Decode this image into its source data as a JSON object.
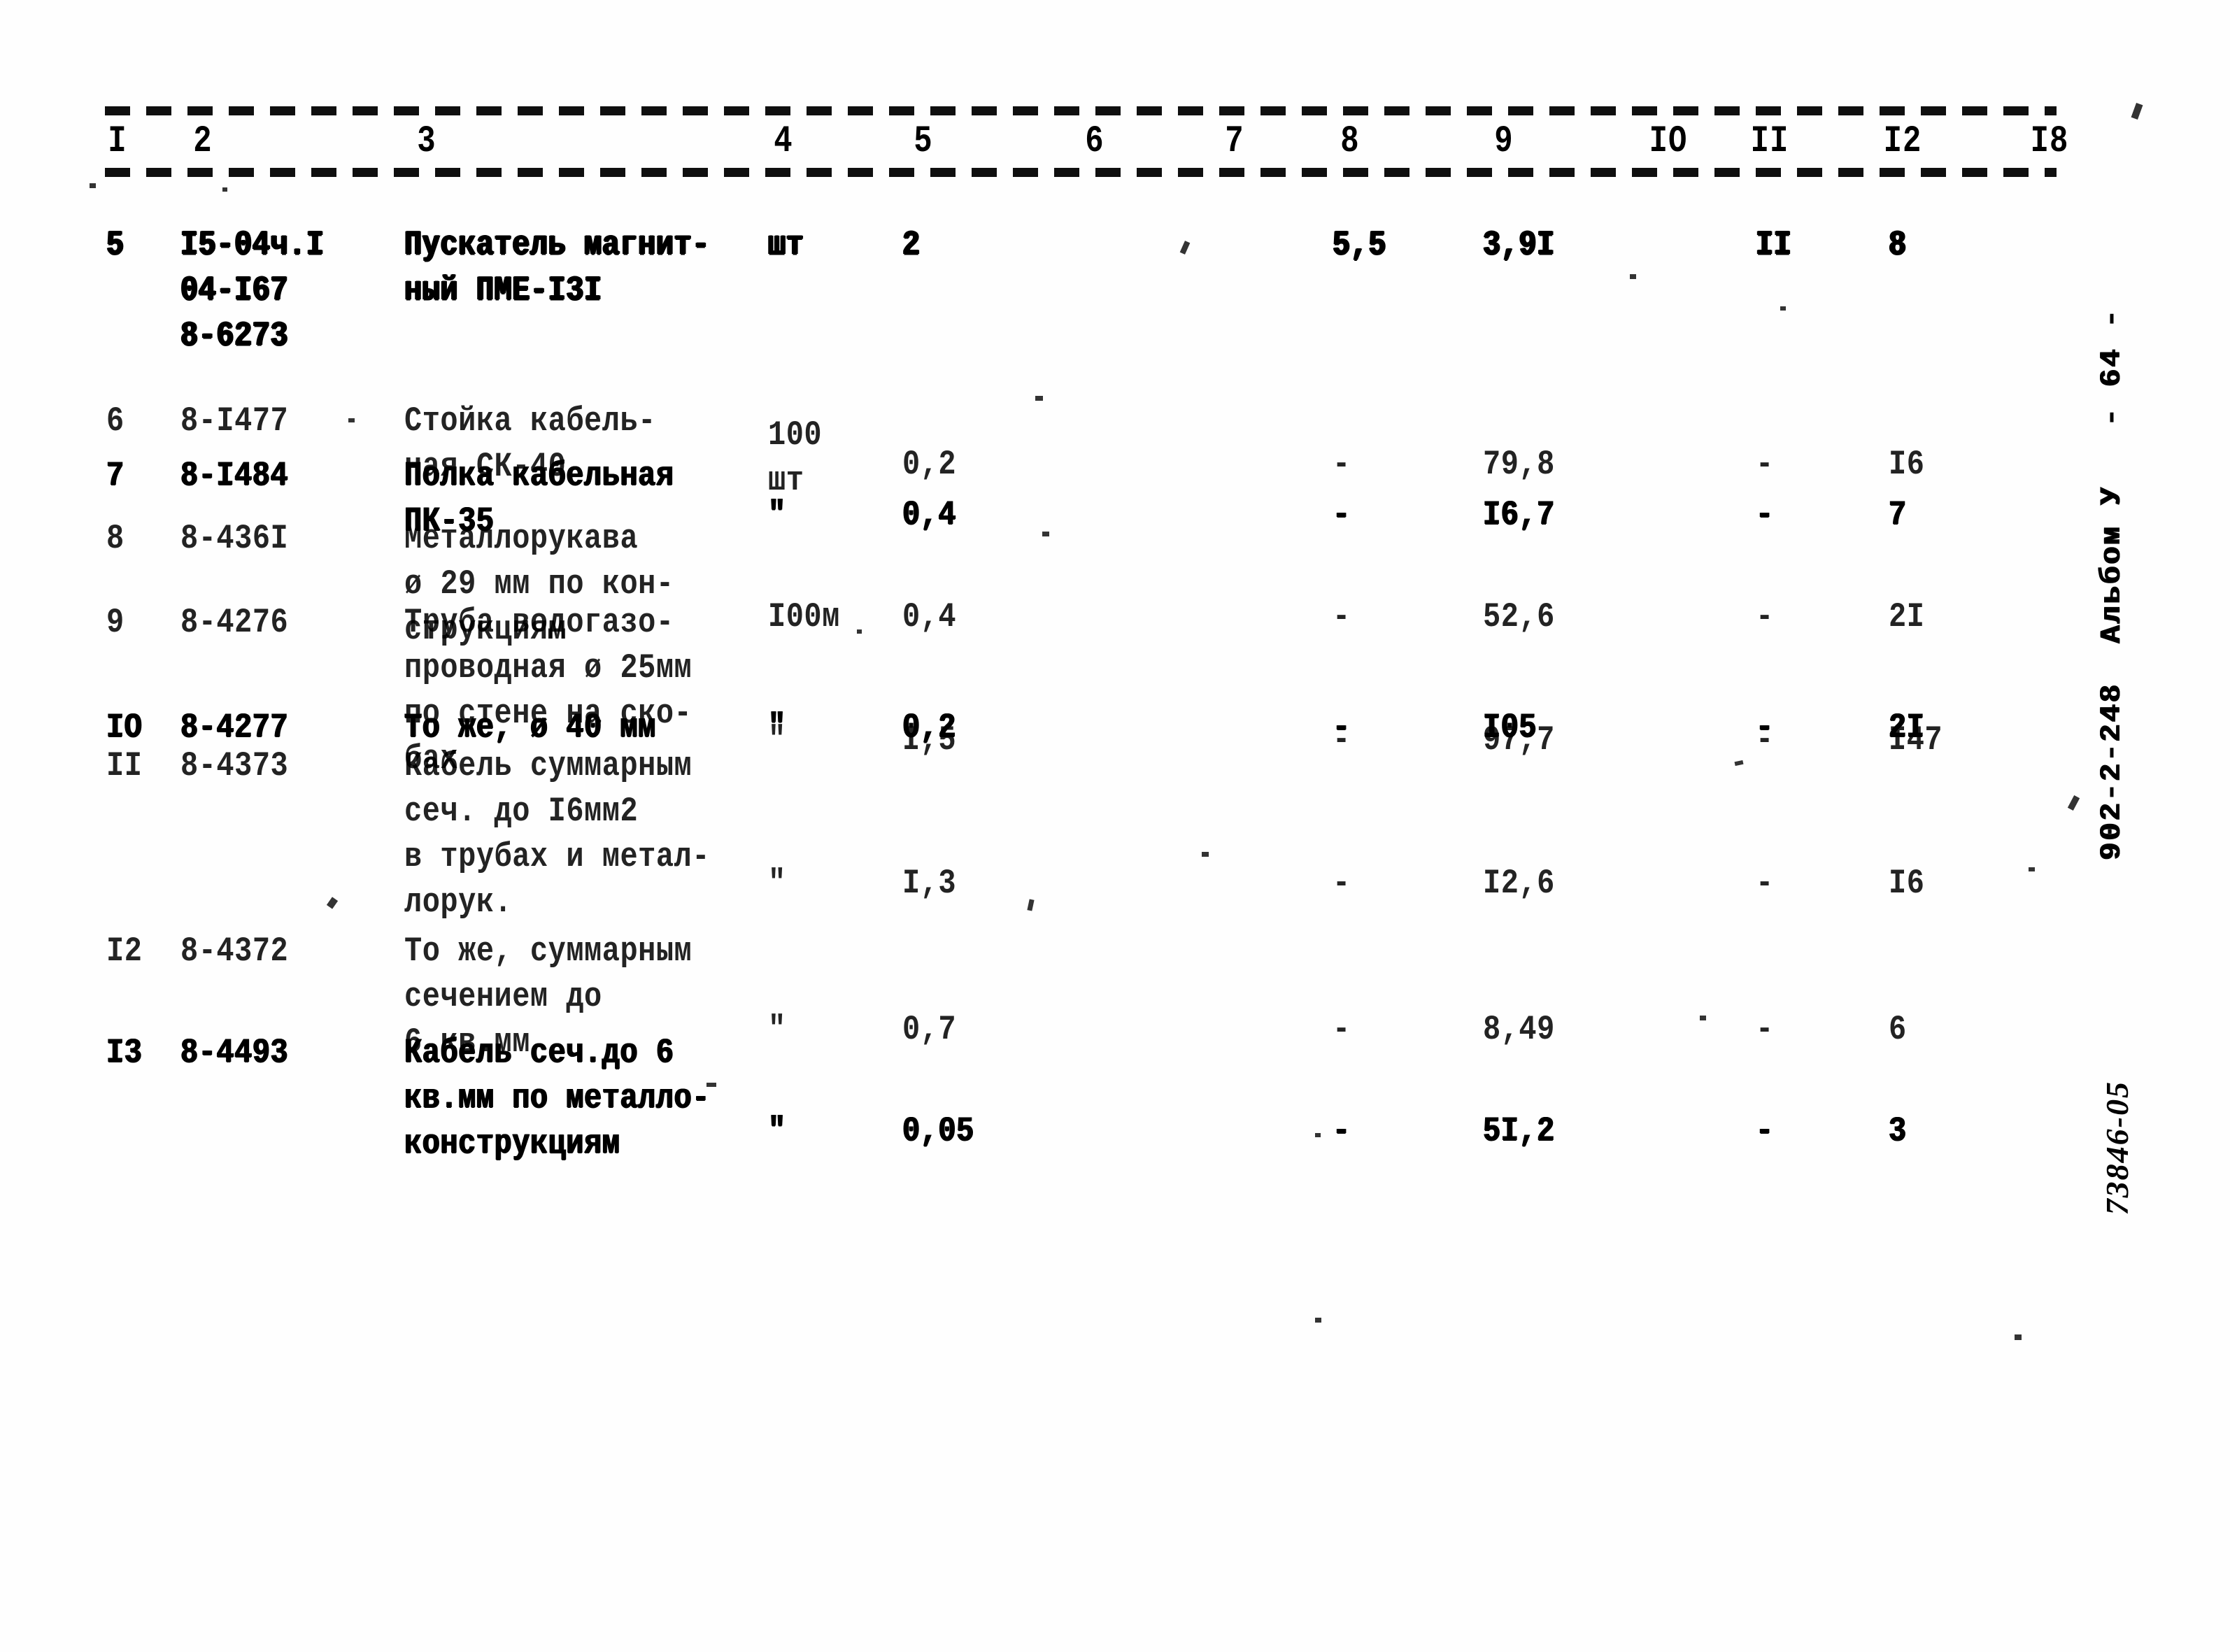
{
  "document": {
    "kind": "scanned-estimate-table",
    "album_stamp": "902-2-248  Альбом У   - 64 -",
    "handwritten_note": "73846-05"
  },
  "table": {
    "column_headers": [
      "I",
      "2",
      "3",
      "4",
      "5",
      "6",
      "7",
      "8",
      "9",
      "IO",
      "II",
      "I2",
      "I8"
    ],
    "rows": [
      {
        "num": "5",
        "code": "I5-04ч.I\n04-I67\n8-6273",
        "name": "Пускатель магнит-\nный ПМЕ-I3I",
        "unit": "шт",
        "qty": "2",
        "c6": "",
        "c7": "",
        "c8": "5,5",
        "c9": "3,9I",
        "c10": "",
        "c11": "II",
        "c12": "8",
        "c13": ""
      },
      {
        "num": "6",
        "code": "8-I477",
        "name": "Стойка кабель-\nная СК-40",
        "unit": "100\nшт",
        "qty": "0,2",
        "c6": "",
        "c7": "",
        "c8": "-",
        "c9": "79,8",
        "c10": "",
        "c11": "-",
        "c12": "I6",
        "c13": ""
      },
      {
        "num": "7",
        "code": "8-I484",
        "name": "Полка кабельная\n   ПК-35",
        "unit": "\"",
        "qty": "0,4",
        "c6": "",
        "c7": "",
        "c8": "-",
        "c9": "I6,7",
        "c10": "",
        "c11": "-",
        "c12": "7",
        "c13": ""
      },
      {
        "num": "8",
        "code": "8-436I",
        "name": "Металлорукава\nø 29 мм по кон-\nструкциям",
        "unit": "I00м",
        "qty": "0,4",
        "c6": "",
        "c7": "",
        "c8": "-",
        "c9": "52,6",
        "c10": "",
        "c11": "-",
        "c12": "2I",
        "c13": ""
      },
      {
        "num": "9",
        "code": "8-4276",
        "name": "Труба водогазо-\nпроводная ø 25мм\nпо стене на ско-\nбах",
        "unit": "\"",
        "qty": "I,5",
        "c6": "",
        "c7": "",
        "c8": "-",
        "c9": "97,7",
        "c10": "",
        "c11": "-",
        "c12": "I47",
        "c13": ""
      },
      {
        "num": "IO",
        "code": "8-4277",
        "name": "То же, ø 40 мм",
        "unit": "\"",
        "qty": "0,2",
        "c6": "",
        "c7": "",
        "c8": "-",
        "c9": "I05",
        "c10": "",
        "c11": "-",
        "c12": "2I",
        "c13": ""
      },
      {
        "num": "II",
        "code": "8-4373",
        "name": "Кабель суммарным\nсеч. до I6мм2\nв  трубах и метал-\nлорук.",
        "unit": "\"",
        "qty": "I,3",
        "c6": "",
        "c7": "",
        "c8": "-",
        "c9": "I2,6",
        "c10": "",
        "c11": "-",
        "c12": "I6",
        "c13": ""
      },
      {
        "num": "I2",
        "code": "8-4372",
        "name": "То же, суммарным\nсечением до\n6 кв.мм",
        "unit": "\"",
        "qty": "0,7",
        "c6": "",
        "c7": "",
        "c8": "-",
        "c9": "8,49",
        "c10": "",
        "c11": "-",
        "c12": "6",
        "c13": ""
      },
      {
        "num": "I3",
        "code": "8-4493",
        "name": "Кабель сеч.до 6\nкв.мм по металло-\nконструкциям",
        "unit": "\"",
        "qty": "0,05",
        "c6": "",
        "c7": "",
        "c8": "-",
        "c9": "5I,2",
        "c10": "",
        "c11": "-",
        "c12": "3",
        "c13": ""
      }
    ]
  },
  "layout": {
    "header_x": [
      168,
      290,
      610,
      1120,
      1320,
      1565,
      1765,
      1930,
      2150,
      2385,
      2530,
      2720,
      2930
    ],
    "row_tops": [
      0,
      252,
      330,
      420,
      540,
      690,
      745,
      1010,
      1155
    ],
    "row_cell_offsets": {
      "5": {
        "unit": 0,
        "qty": 0,
        "c8": 0,
        "c9": 0,
        "c11": 0,
        "c12": 0
      },
      "6": {
        "unit": 20,
        "qty": 62,
        "c8": 62,
        "c9": 62,
        "c11": 62,
        "c12": 62
      },
      "7": {
        "unit": 56,
        "qty": 56,
        "c8": 56,
        "c9": 56,
        "c11": 56,
        "c12": 56
      },
      "8": {
        "unit": 112,
        "qty": 112,
        "c8": 112,
        "c9": 112,
        "c11": 112,
        "c12": 112
      },
      "9": {
        "unit": 168,
        "qty": 168,
        "c8": 168,
        "c9": 168,
        "c11": 168,
        "c12": 168
      },
      "IO": {
        "unit": 0,
        "qty": 0,
        "c8": 0,
        "c9": 0,
        "c11": 0,
        "c12": 0
      },
      "II": {
        "unit": 168,
        "qty": 168,
        "c8": 168,
        "c9": 168,
        "c11": 168,
        "c12": 168
      },
      "I2": {
        "unit": 112,
        "qty": 112,
        "c8": 112,
        "c9": 112,
        "c11": 112,
        "c12": 112
      },
      "I3": {
        "unit": 112,
        "qty": 112,
        "c8": 112,
        "c9": 112,
        "c11": 112,
        "c12": 112
      }
    }
  }
}
